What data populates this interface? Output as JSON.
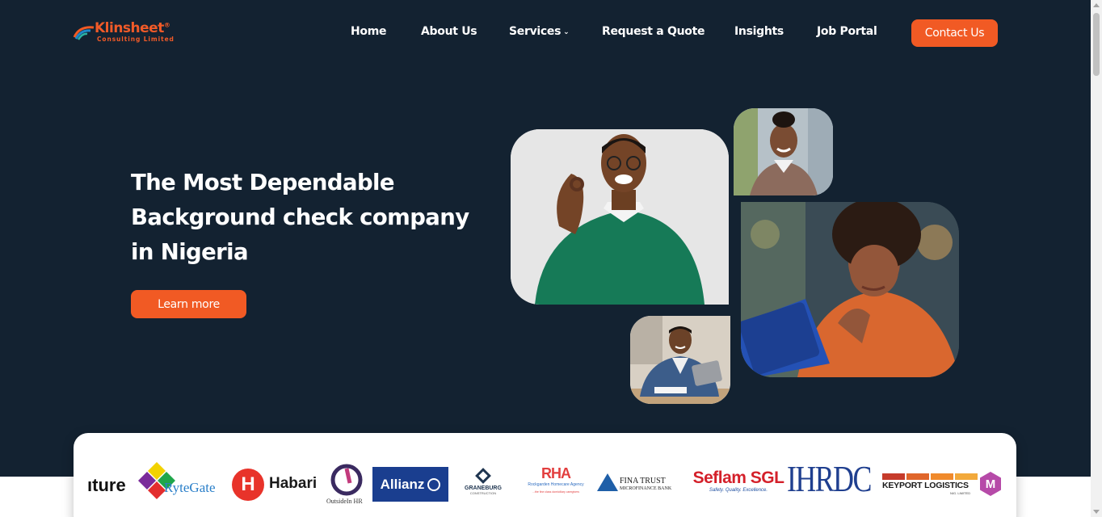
{
  "brand": {
    "name": "Klinsheet",
    "reg": "®",
    "tagline": "Consulting Limited",
    "accent_color": "#f15a24",
    "background_color": "#132231"
  },
  "nav": {
    "items": [
      {
        "label": "Home"
      },
      {
        "label": "About Us"
      },
      {
        "label": "Services",
        "icon": "chevron-down-icon",
        "chevron": "⌄"
      },
      {
        "label": "Request a Quote"
      },
      {
        "label": "Insights"
      },
      {
        "label": "Job Portal"
      }
    ],
    "contact_label": "Contact Us"
  },
  "hero": {
    "title_line1": "The Most Dependable",
    "title_line2": "Background check company",
    "title_line3": "in Nigeria",
    "cta_label": "Learn more"
  },
  "partners": {
    "logos": [
      {
        "name": "nature",
        "text": "ıture"
      },
      {
        "name": "rytegate",
        "text": "RyteGate",
        "initial": "R"
      },
      {
        "name": "habari",
        "text": "Habari",
        "mark": "H"
      },
      {
        "name": "outsidein-hr",
        "text": "OutsideIn HR"
      },
      {
        "name": "allianz",
        "text": "Allianz"
      },
      {
        "name": "graneburg",
        "text": "GRANEBURG",
        "sub": "CONSTRUCTION"
      },
      {
        "name": "rockgarden",
        "text": "RHA",
        "sub": "Rockgarden Homecare Agency",
        "sub2": "...the fine class domiciliary caregivers"
      },
      {
        "name": "finatrust",
        "text": "FINA TRUST",
        "sub": "MICROFINANCE BANK"
      },
      {
        "name": "seflam",
        "text": "Seflam SGL",
        "sub": "Safety. Quality. Excellence."
      },
      {
        "name": "ihrdc",
        "text": "IHRDC"
      },
      {
        "name": "keyport",
        "text": "KEYPORT LOGISTICS",
        "sub": "NIG. LIMITED"
      },
      {
        "name": "m-logo",
        "text": "M"
      }
    ]
  }
}
